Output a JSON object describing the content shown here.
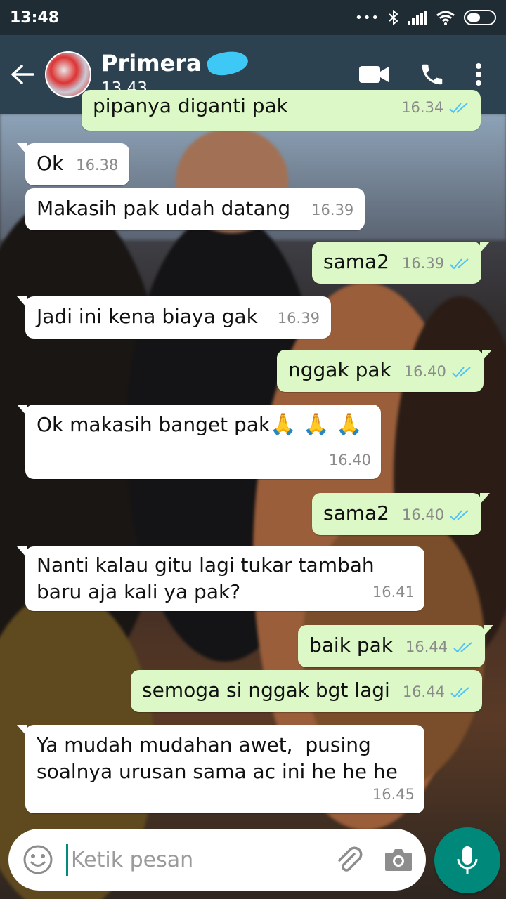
{
  "status_bar": {
    "time": "13:48",
    "dots": "•••"
  },
  "header": {
    "chat_name": "Primera",
    "last_seen": "13.43"
  },
  "messages": [
    {
      "text": "pipanya diganti pak",
      "time": "16.34",
      "dir": "out"
    },
    {
      "text": "Ok",
      "time": "16.38",
      "dir": "in"
    },
    {
      "text": "Makasih pak udah datang",
      "time": "16.39",
      "dir": "in"
    },
    {
      "text": "sama2",
      "time": "16.39",
      "dir": "out"
    },
    {
      "text": "Jadi ini kena biaya gak",
      "time": "16.39",
      "dir": "in"
    },
    {
      "text": "nggak pak",
      "time": "16.40",
      "dir": "out"
    },
    {
      "text": "Ok makasih banget pak",
      "emoji": "🙏 🙏 🙏",
      "time": "16.40",
      "dir": "in"
    },
    {
      "text": "sama2",
      "time": "16.40",
      "dir": "out"
    },
    {
      "line1": "Nanti kalau gitu lagi tukar tambah",
      "line2": "baru aja kali ya pak?",
      "time": "16.41",
      "dir": "in"
    },
    {
      "text": "baik pak",
      "time": "16.44",
      "dir": "out"
    },
    {
      "text": "semoga si nggak bgt lagi",
      "time": "16.44",
      "dir": "out"
    },
    {
      "line1": "Ya mudah mudahan awet,  pusing",
      "line2": "soalnya urusan sama ac ini he he he",
      "time": "16.45",
      "dir": "in"
    }
  ],
  "composer": {
    "placeholder": "Ketik pesan"
  },
  "colors": {
    "header": "#2d4250",
    "outgoing": "#dcf8c6",
    "incoming": "#ffffff",
    "tick_read": "#4fc3f7",
    "mic": "#00897b"
  },
  "icons": [
    "back-arrow-icon",
    "video-call-icon",
    "phone-icon",
    "more-vert-icon",
    "emoji-icon",
    "attach-icon",
    "camera-icon",
    "mic-icon",
    "double-tick-icon"
  ]
}
